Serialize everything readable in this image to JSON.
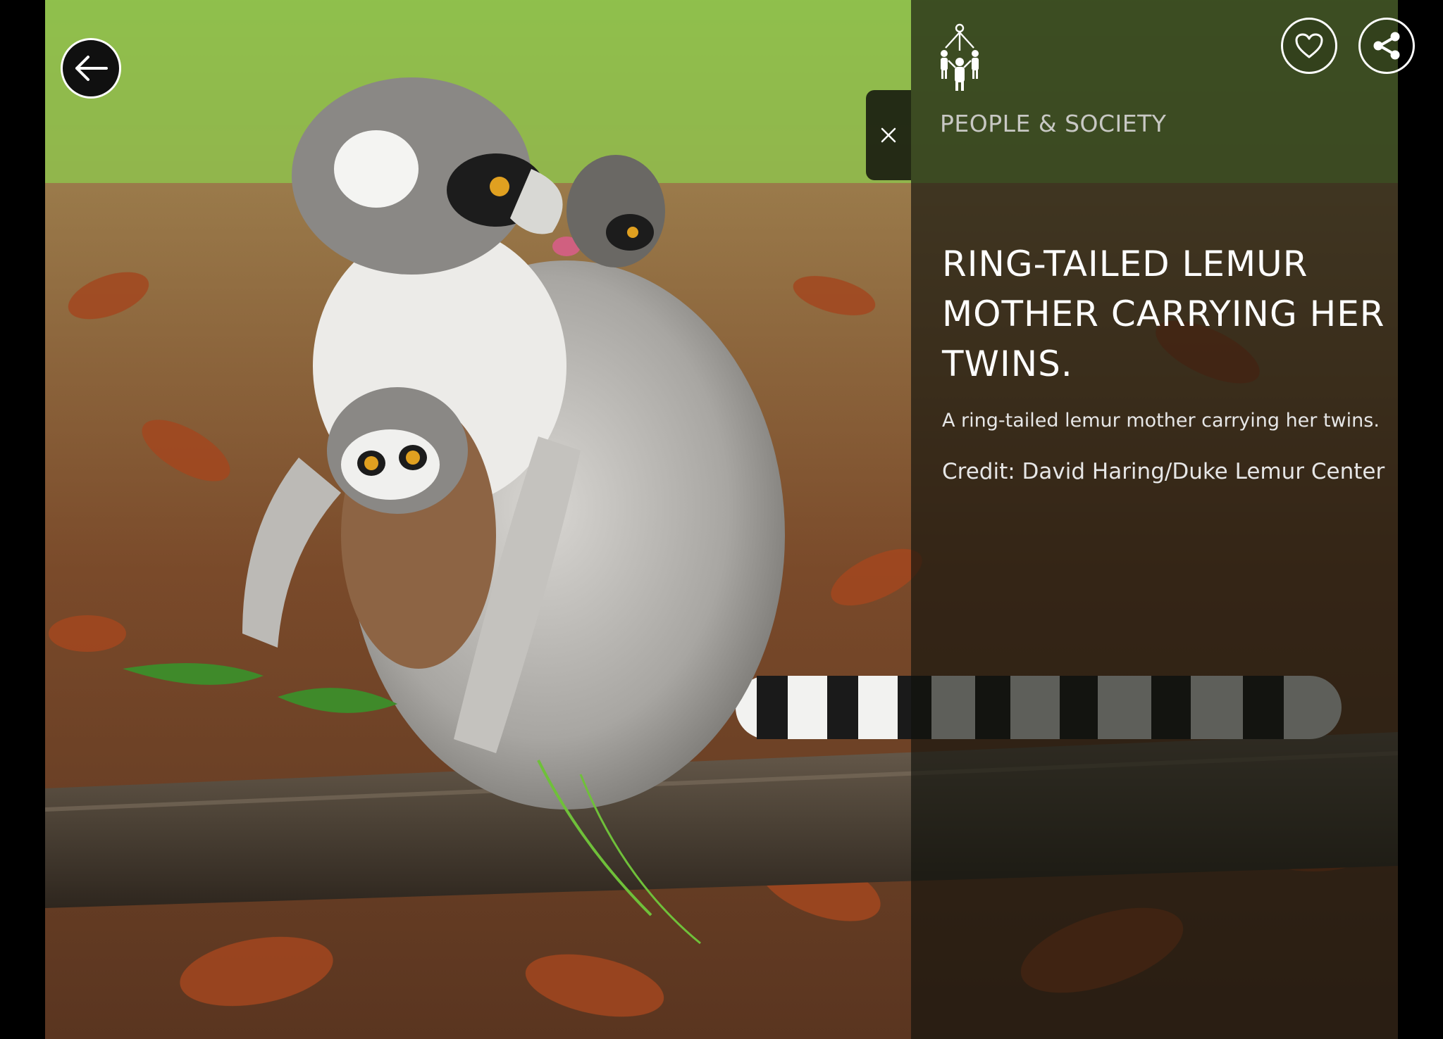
{
  "photo": {
    "subject": "ring-tailed lemur mother with twins"
  },
  "navigation": {
    "back_icon": "arrow-left-icon"
  },
  "actions": {
    "favorite_icon": "heart-icon",
    "share_icon": "share-icon",
    "close_icon": "close-icon"
  },
  "category": {
    "icon": "people-network-icon",
    "label": "PEOPLE & SOCIETY"
  },
  "caption": {
    "title": "RING-TAILED LEMUR MOTHER CARRYING HER TWINS.",
    "description": "A ring-tailed lemur mother carrying her twins.",
    "credit": "Credit: David Haring/Duke Lemur Center"
  },
  "colors": {
    "panel_overlay": "#10120c",
    "text": "#ffffff",
    "category_text": "#c8c8c4"
  }
}
